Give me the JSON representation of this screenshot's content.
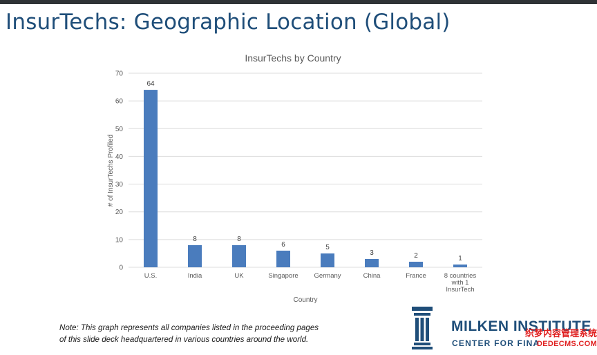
{
  "slide": {
    "title": "InsurTechs: Geographic Location (Global)",
    "note_line1": "Note: This graph represents all companies listed in the proceeding pages",
    "note_line2": "of this slide deck headquartered in various countries around the world."
  },
  "chart_data": {
    "type": "bar",
    "title": "InsurTechs by Country",
    "xlabel": "Country",
    "ylabel": "# of InsurTechs Profiled",
    "categories": [
      "U.S.",
      "India",
      "UK",
      "Singapore",
      "Germany",
      "China",
      "France",
      "8 countries with 1 InsurTech"
    ],
    "category_lines": [
      [
        "U.S."
      ],
      [
        "India"
      ],
      [
        "UK"
      ],
      [
        "Singapore"
      ],
      [
        "Germany"
      ],
      [
        "China"
      ],
      [
        "France"
      ],
      [
        "8 countries",
        "with 1",
        "InsurTech"
      ]
    ],
    "values": [
      64,
      8,
      8,
      6,
      5,
      3,
      2,
      1
    ],
    "ylim": [
      0,
      70
    ],
    "yticks": [
      0,
      10,
      20,
      30,
      40,
      50,
      60,
      70
    ],
    "grid": true,
    "data_labels": true,
    "bar_color": "#4a7cbd",
    "grid_color": "#dcdcdc"
  },
  "logo": {
    "name": "MILKEN INSTITUTE",
    "subtitle": "CENTER FOR FINA",
    "color": "#1f4e79",
    "icon": "building-columns-icon"
  },
  "watermark": {
    "line1": "织梦内容管理系统",
    "line2": "DEDECMS.COM",
    "color": "#e02020"
  }
}
